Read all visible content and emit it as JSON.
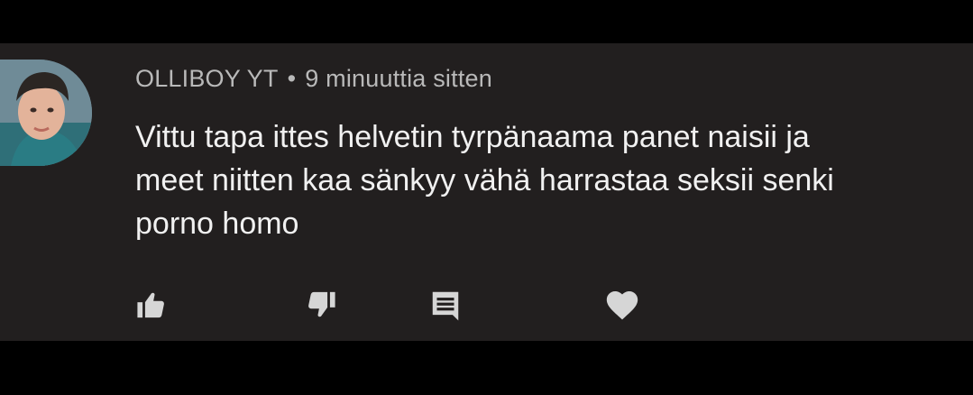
{
  "comment": {
    "author": "OLLIBOY YT",
    "separator": "•",
    "timestamp": "9 minuuttia sitten",
    "text_lines": [
      "Vittu tapa ittes helvetin tyrpänaama panet naisii ja",
      "meet niitten kaa sänkyy vähä harrastaa seksii senki",
      "porno homo"
    ]
  },
  "actions": {
    "like_icon": "thumbs-up-icon",
    "dislike_icon": "thumbs-down-icon",
    "reply_icon": "comment-icon",
    "heart_icon": "heart-icon"
  },
  "colors": {
    "background": "#221f1f",
    "author_text": "#b9b9b9",
    "body_text": "#f1f1f1",
    "icon": "#d6d6d6"
  }
}
